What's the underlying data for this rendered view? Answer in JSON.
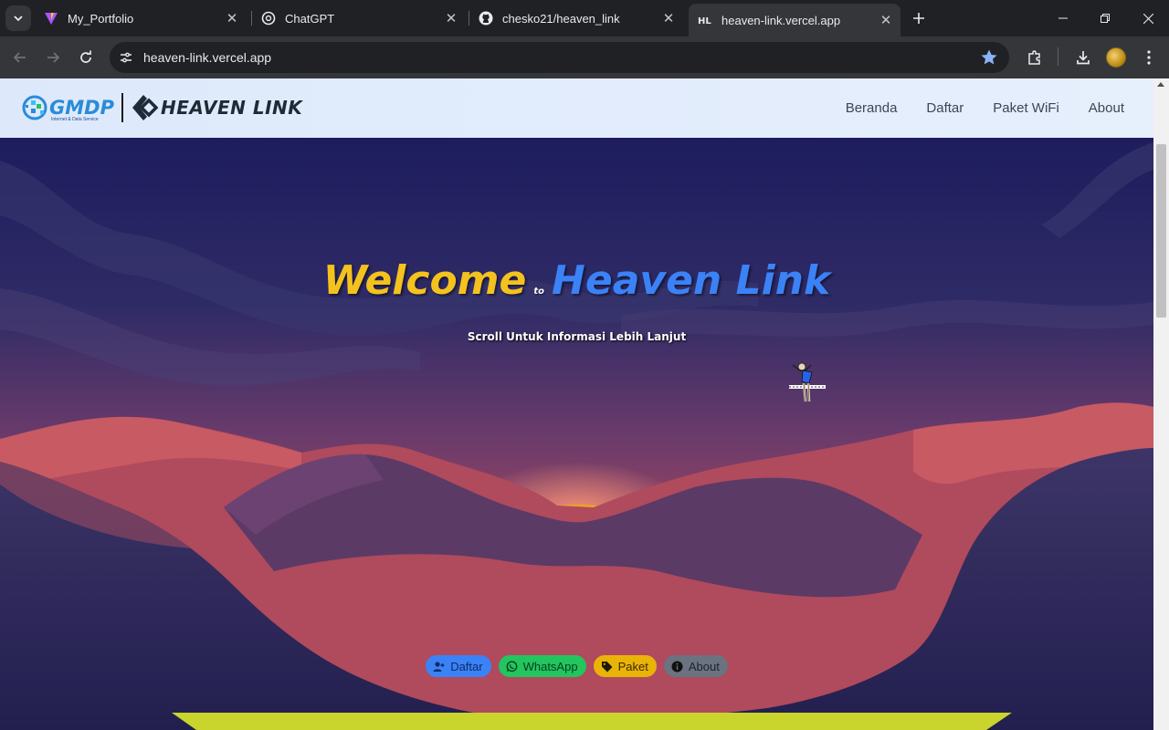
{
  "browser": {
    "tabs": [
      {
        "title": "My_Portfolio",
        "icon": "vite-icon"
      },
      {
        "title": "ChatGPT",
        "icon": "chatgpt-icon"
      },
      {
        "title": "chesko21/heaven_link",
        "icon": "github-icon"
      },
      {
        "title": "heaven-link.vercel.app",
        "icon": "hl-icon",
        "active": true
      }
    ],
    "url": "heaven-link.vercel.app",
    "accent": "#8ab4f8"
  },
  "site": {
    "logo": {
      "brand1": "GMDP",
      "brand1_sub": "Internet & Data Service",
      "brand2": "HEAVEN LINK"
    },
    "nav": [
      "Beranda",
      "Daftar",
      "Paket WiFi",
      "About"
    ],
    "hero": {
      "welcome": "Welcome",
      "to": "to",
      "name": "Heaven Link",
      "subtitle": "Scroll Untuk Informasi Lebih Lanjut"
    },
    "buttons": [
      {
        "label": "Daftar",
        "icon": "user-plus-icon",
        "color": "#3b82f6"
      },
      {
        "label": "WhatsApp",
        "icon": "whatsapp-icon",
        "color": "#22c55e"
      },
      {
        "label": "Paket",
        "icon": "tag-icon",
        "color": "#eab308"
      },
      {
        "label": "About",
        "icon": "info-icon",
        "color": "#6b7280"
      }
    ]
  }
}
